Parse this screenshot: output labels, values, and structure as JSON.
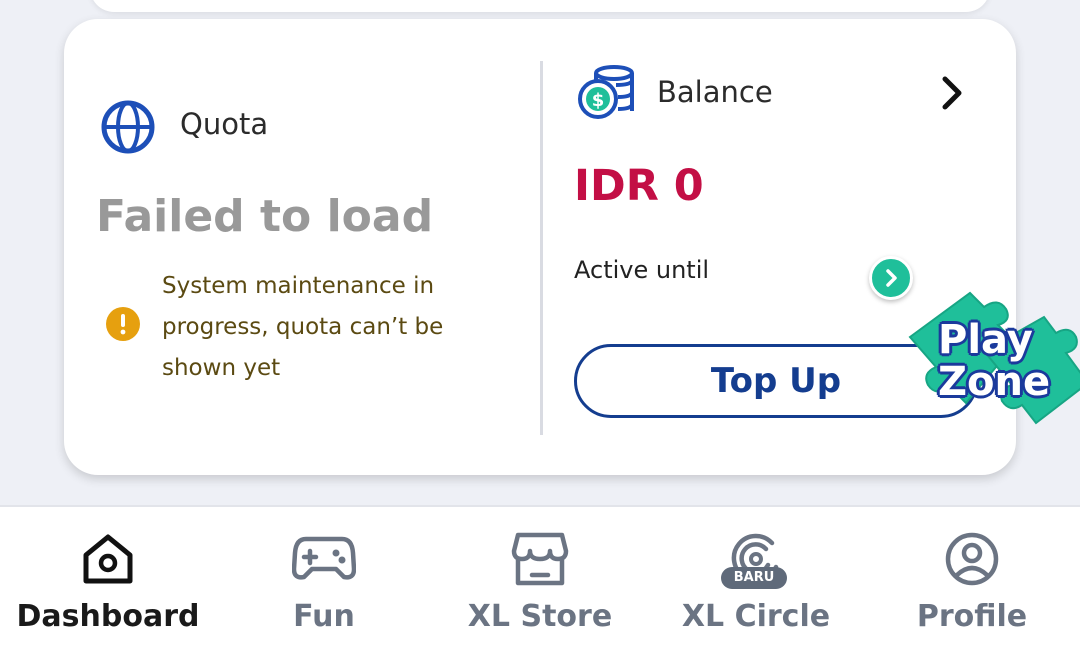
{
  "quota": {
    "label": "Quota",
    "status": "Failed to load",
    "warning_message": "System maintenance in progress, quota can’t be shown yet"
  },
  "balance": {
    "label": "Balance",
    "amount": "IDR 0",
    "active_until_label": "Active until",
    "top_up_label": "Top Up"
  },
  "playzone": {
    "line1": "Play",
    "line2": "Zone"
  },
  "bottom_nav": {
    "items": [
      {
        "label": "Dashboard",
        "icon": "home-icon",
        "active": true
      },
      {
        "label": "Fun",
        "icon": "gamepad-icon",
        "active": false
      },
      {
        "label": "XL Store",
        "icon": "store-icon",
        "active": false
      },
      {
        "label": "XL Circle",
        "icon": "circle-icon",
        "active": false
      },
      {
        "label": "Profile",
        "icon": "profile-icon",
        "active": false
      }
    ],
    "badge": "BARU"
  },
  "colors": {
    "accent_blue": "#143d8f",
    "balance_red": "#c30f45",
    "warning_orange": "#e6a00f",
    "playzone_green": "#1fbf9a"
  }
}
